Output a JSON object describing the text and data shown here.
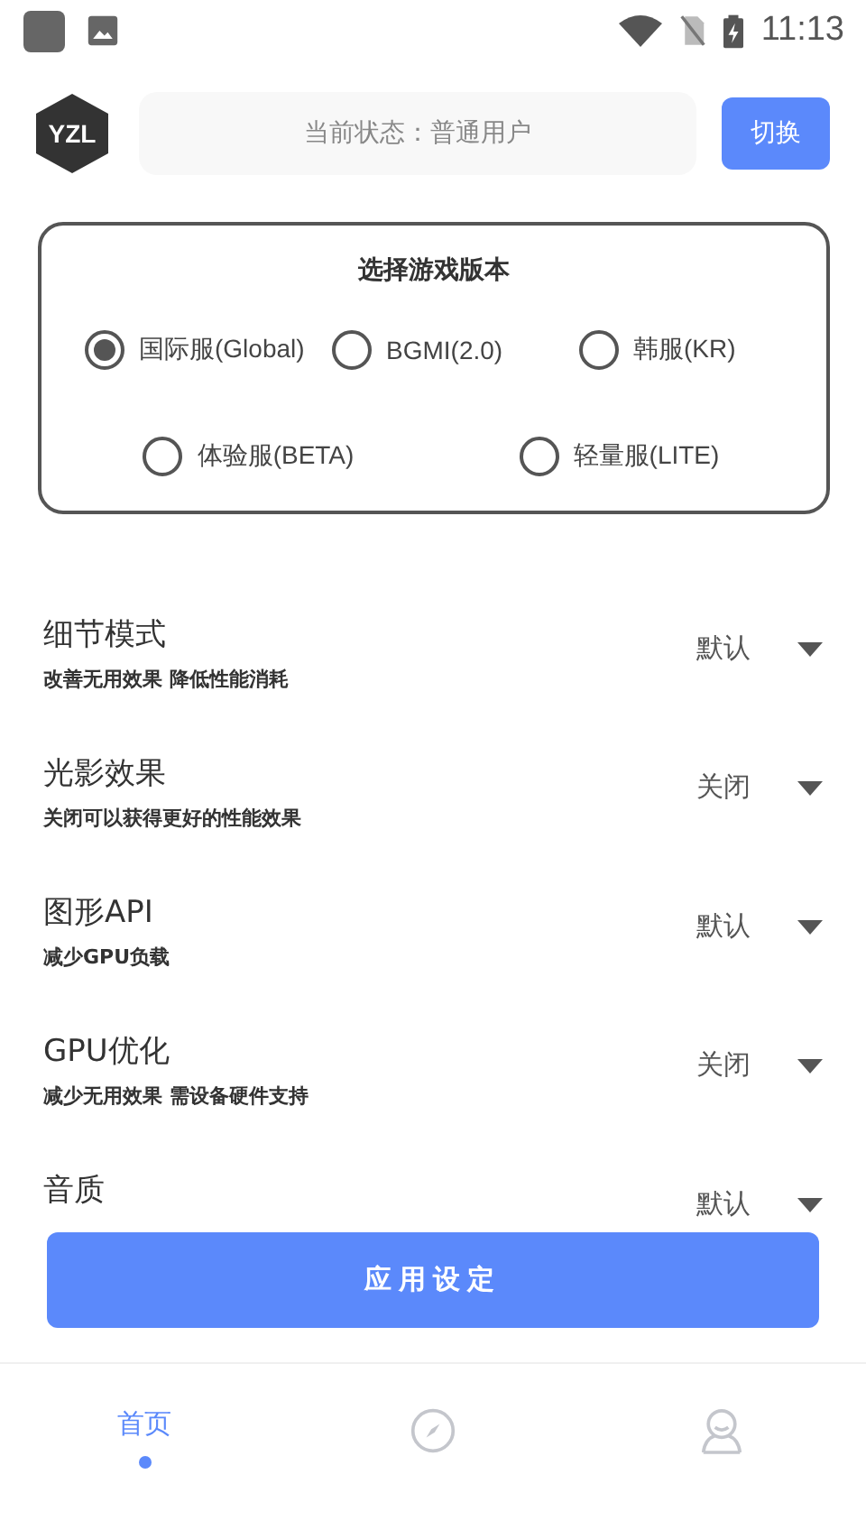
{
  "status_bar": {
    "time": "11:13"
  },
  "header": {
    "logo": "YZL",
    "status": "当前状态：普通用户",
    "switch_button": "切换"
  },
  "dialog": {
    "title": "选择游戏版本",
    "options": [
      {
        "label": "国际服(Global)",
        "selected": true
      },
      {
        "label": "BGMI(2.0)",
        "selected": false
      },
      {
        "label": "韩服(KR)",
        "selected": false
      },
      {
        "label": "体验服(BETA)",
        "selected": false
      },
      {
        "label": "轻量服(LITE)",
        "selected": false
      }
    ]
  },
  "settings": [
    {
      "title": "细节模式",
      "subtitle": "改善无用效果 降低性能消耗",
      "value": "默认"
    },
    {
      "title": "光影效果",
      "subtitle": "关闭可以获得更好的性能效果",
      "value": "关闭"
    },
    {
      "title": "图形API",
      "subtitle": "减少GPU负载",
      "value": "默认"
    },
    {
      "title": "GPU优化",
      "subtitle": "减少无用效果 需设备硬件支持",
      "value": "关闭"
    },
    {
      "title": "音质",
      "value": "默认"
    }
  ],
  "apply_button": "应用设定",
  "nav": [
    {
      "label": "首页",
      "selected": true
    },
    {
      "kind": "compass",
      "selected": false
    },
    {
      "kind": "person",
      "selected": false
    }
  ]
}
